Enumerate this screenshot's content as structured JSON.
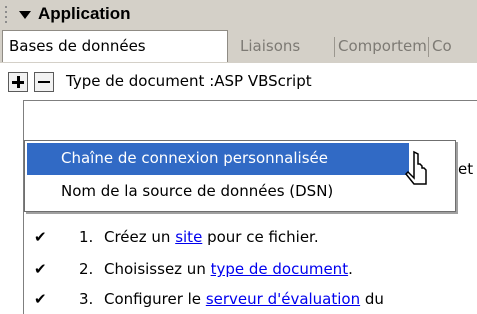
{
  "header": {
    "title": "Application"
  },
  "tabs": [
    {
      "label": "Bases de données"
    },
    {
      "label": "Liaisons"
    },
    {
      "label": "Comportem"
    },
    {
      "label": "Co"
    }
  ],
  "toolbar": {
    "document_type": "Type de document :ASP VBScript"
  },
  "menu": {
    "items": [
      {
        "label": "Chaîne de connexion personnalisée"
      },
      {
        "label": "Nom de la source de données (DSN)"
      }
    ]
  },
  "content": {
    "truncated_edge_text": "et",
    "steps": [
      {
        "check": "✔",
        "num": "1.",
        "prefix": "Créez un ",
        "link": "site",
        "suffix": " pour ce fichier."
      },
      {
        "check": "✔",
        "num": "2.",
        "prefix": "Choisissez un ",
        "link": "type de document",
        "suffix": "."
      },
      {
        "check": "✔",
        "num": "3.",
        "prefix": "Configurer le ",
        "link": "serveur d'évaluation",
        "suffix": " du"
      }
    ]
  },
  "colors": {
    "menu_highlight": "#316ac5",
    "link": "#0000ee",
    "panel_bg": "#d4d0c8"
  }
}
